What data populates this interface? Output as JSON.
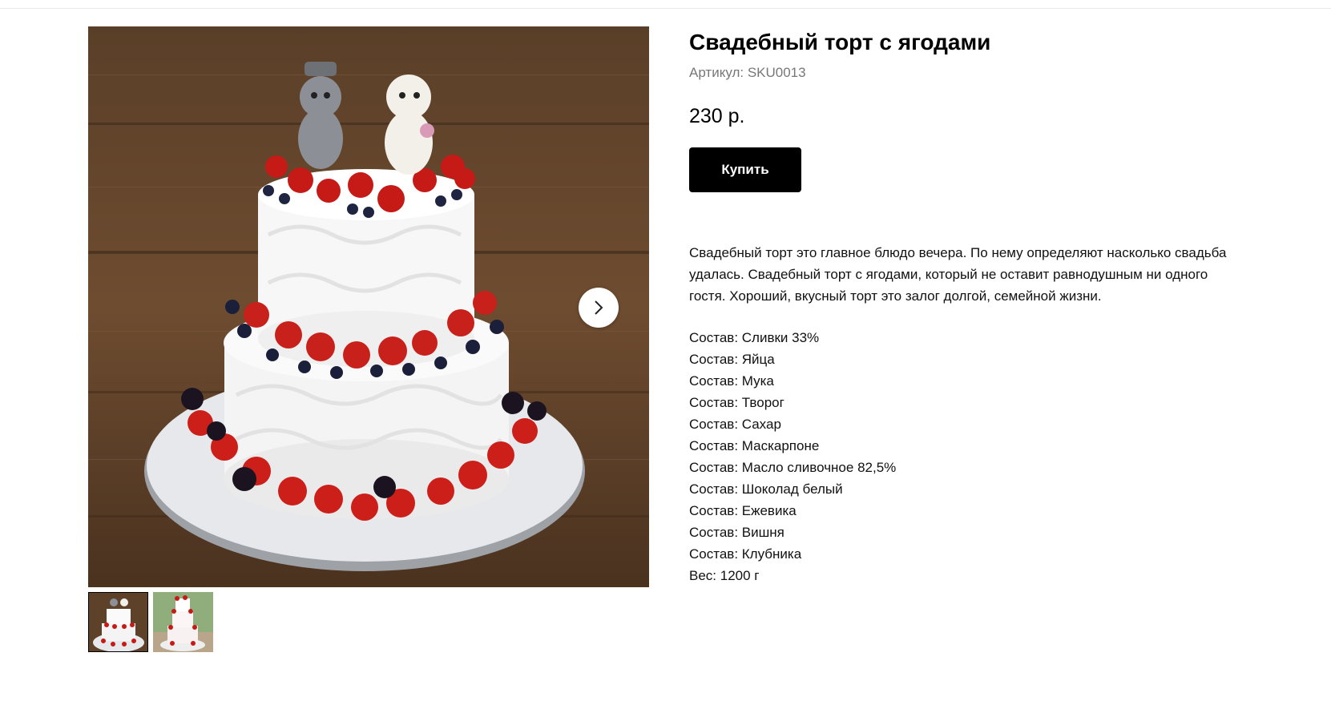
{
  "product": {
    "title": "Свадебный торт с ягодами",
    "sku": "Артикул: SKU0013",
    "price": "230 р.",
    "buy_label": "Купить",
    "description": "Свадебный торт это главное блюдо вечера. По нему определяют насколько свадьба удалась. Свадебный торт с ягодами, который не оставит равнодушным ни одного гостя. Хороший, вкусный торт это залог долгой, семейной жизни.",
    "properties": [
      "Состав: Сливки 33%",
      "Состав: Яйца",
      "Состав: Мука",
      "Состав: Творог",
      "Состав: Сахар",
      "Состав: Маскарпоне",
      "Состав: Масло сливочное 82,5%",
      "Состав: Шоколад белый",
      "Состав: Ежевика",
      "Состав: Вишня",
      "Состав: Клубника",
      "Вес: 1200 г"
    ]
  },
  "gallery": {
    "next_icon": "chevron-right-icon",
    "active_thumb": 1,
    "thumb_count": 2
  },
  "colors": {
    "button_bg": "#000000",
    "button_text": "#ffffff",
    "sku_text": "#777777"
  }
}
